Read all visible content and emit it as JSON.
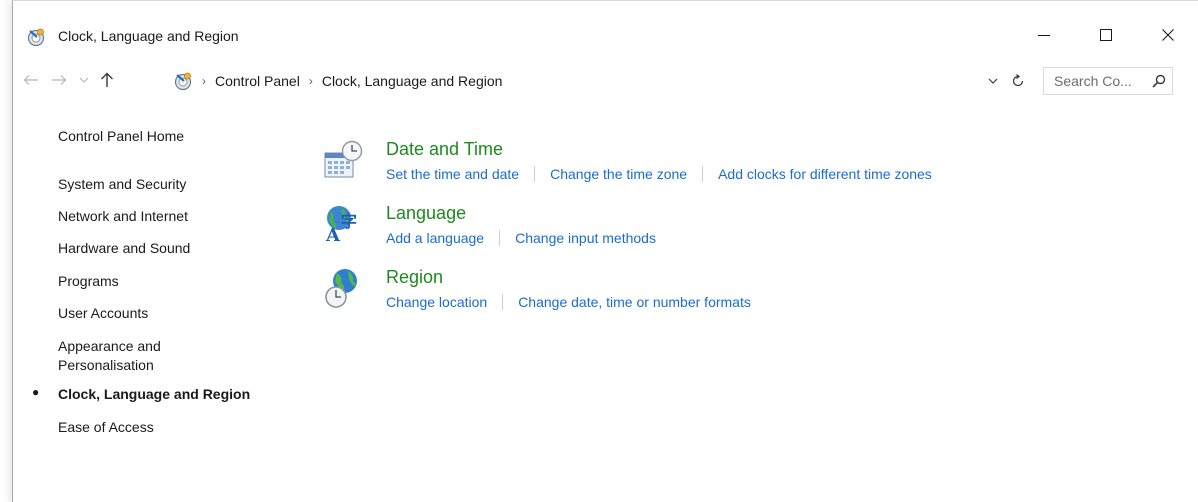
{
  "window": {
    "title": "Clock, Language and Region"
  },
  "address": {
    "crumbs": [
      "Control Panel",
      "Clock, Language and Region"
    ]
  },
  "search": {
    "placeholder": "Search Co..."
  },
  "sidebar": {
    "items": [
      {
        "label": "Control Panel Home"
      },
      {
        "label": "System and Security"
      },
      {
        "label": "Network and Internet"
      },
      {
        "label": "Hardware and Sound"
      },
      {
        "label": "Programs"
      },
      {
        "label": "User Accounts"
      },
      {
        "label": "Appearance and",
        "label2": "Personalisation"
      },
      {
        "label": "Clock, Language and Region",
        "active": true
      },
      {
        "label": "Ease of Access"
      }
    ]
  },
  "categories": [
    {
      "title": "Date and Time",
      "icon": "date-time-icon",
      "links": [
        "Set the time and date",
        "Change the time zone",
        "Add clocks for different time zones"
      ]
    },
    {
      "title": "Language",
      "icon": "language-icon",
      "links": [
        "Add a language",
        "Change input methods"
      ]
    },
    {
      "title": "Region",
      "icon": "region-icon",
      "links": [
        "Change location",
        "Change date, time or number formats"
      ]
    }
  ],
  "colors": {
    "category_title": "#1c8a1c",
    "link": "#1b6ccf",
    "text": "#1a1a1a"
  }
}
